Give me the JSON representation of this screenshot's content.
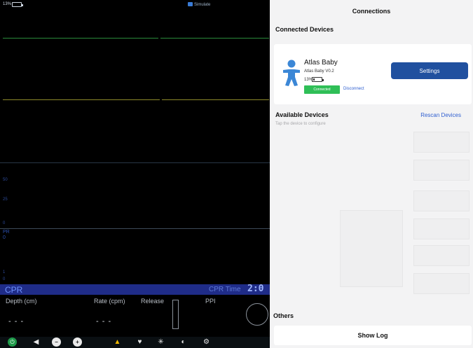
{
  "monitor": {
    "battery_text": "13%",
    "simulate_label": "Simulate",
    "axis_labels": [
      "50",
      "25",
      "0"
    ],
    "pr_label": "PR",
    "pr_value": "0",
    "axis_bottom": [
      "1",
      "0"
    ],
    "cpr": {
      "title": "CPR",
      "time_label": "CPR Time",
      "time_value": "2:0"
    },
    "metrics": {
      "depth_label": "Depth (cm)",
      "depth_value": "- - -",
      "rate_label": "Rate (cpm)",
      "rate_value": "- - -",
      "release_label": "Release",
      "ppi_label": "PPI"
    },
    "toolbar_icons": [
      "power-icon",
      "speaker-icon",
      "minus-icon",
      "plus-icon",
      "bell-icon",
      "heart-icon",
      "snowflake-icon",
      "contrast-icon",
      "gear-icon"
    ]
  },
  "panel": {
    "title": "Connections",
    "connected_section": "Connected Devices",
    "device": {
      "name": "Atlas Baby",
      "version": "Atlas Baby V0.2",
      "battery": "13%",
      "status": "Connected",
      "disconnect_label": "Disconnect",
      "settings_label": "Settings",
      "icon": "baby-icon",
      "icon_color": "#3b87d6"
    },
    "available_section": "Available Devices",
    "available_hint": "Tap the device to configure",
    "rescan_label": "Rescan Devices",
    "others_section": "Others",
    "show_log_label": "Show Log"
  },
  "colors": {
    "accent_blue": "#20509f",
    "link_blue": "#2f5fd0",
    "connected_green": "#2fbf57",
    "cpr_bar": "#1f2c88"
  }
}
